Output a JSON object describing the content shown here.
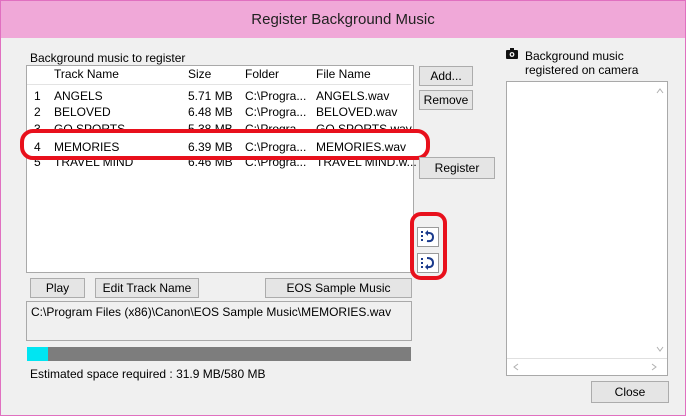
{
  "window": {
    "title": "Register Background Music"
  },
  "left_panel": {
    "group_label": "Background music to register",
    "columns": [
      "Track Name",
      "Size",
      "Folder",
      "File Name"
    ],
    "rows": [
      {
        "num": "1",
        "name": "ANGELS",
        "size": "5.71 MB",
        "folder": "C:\\Progra...",
        "file": "ANGELS.wav"
      },
      {
        "num": "2",
        "name": "BELOVED",
        "size": "6.48 MB",
        "folder": "C:\\Progra...",
        "file": "BELOVED.wav"
      },
      {
        "num": "3",
        "name": "GO SPORTS",
        "size": "5.38 MB",
        "folder": "C:\\Progra...",
        "file": "GO SPORTS.wav"
      },
      {
        "num": "4",
        "name": "MEMORIES",
        "size": "6.39 MB",
        "folder": "C:\\Progra...",
        "file": "MEMORIES.wav"
      },
      {
        "num": "5",
        "name": "TRAVEL MIND",
        "size": "6.46 MB",
        "folder": "C:\\Progra...",
        "file": "TRAVEL MIND.w..."
      }
    ],
    "play_label": "Play",
    "edit_label": "Edit Track Name",
    "sample_label": "EOS Sample Music",
    "path": "C:\\Program Files (x86)\\Canon\\EOS Sample Music\\MEMORIES.wav",
    "progress_fraction": 0.055,
    "space_text": "Estimated space required : 31.9 MB/580 MB"
  },
  "middle": {
    "add_label": "Add...",
    "remove_label": "Remove",
    "register_label": "Register",
    "move_up_icon": "move-up-icon",
    "move_down_icon": "move-down-icon"
  },
  "right_panel": {
    "label_line1": "Background music",
    "label_line2": "registered on camera",
    "close_label": "Close"
  },
  "colors": {
    "titlebar": "#f0a8d8",
    "highlight": "#e8101c",
    "progress_fill": "#00e5f2",
    "progress_track": "#7d7d7d"
  }
}
